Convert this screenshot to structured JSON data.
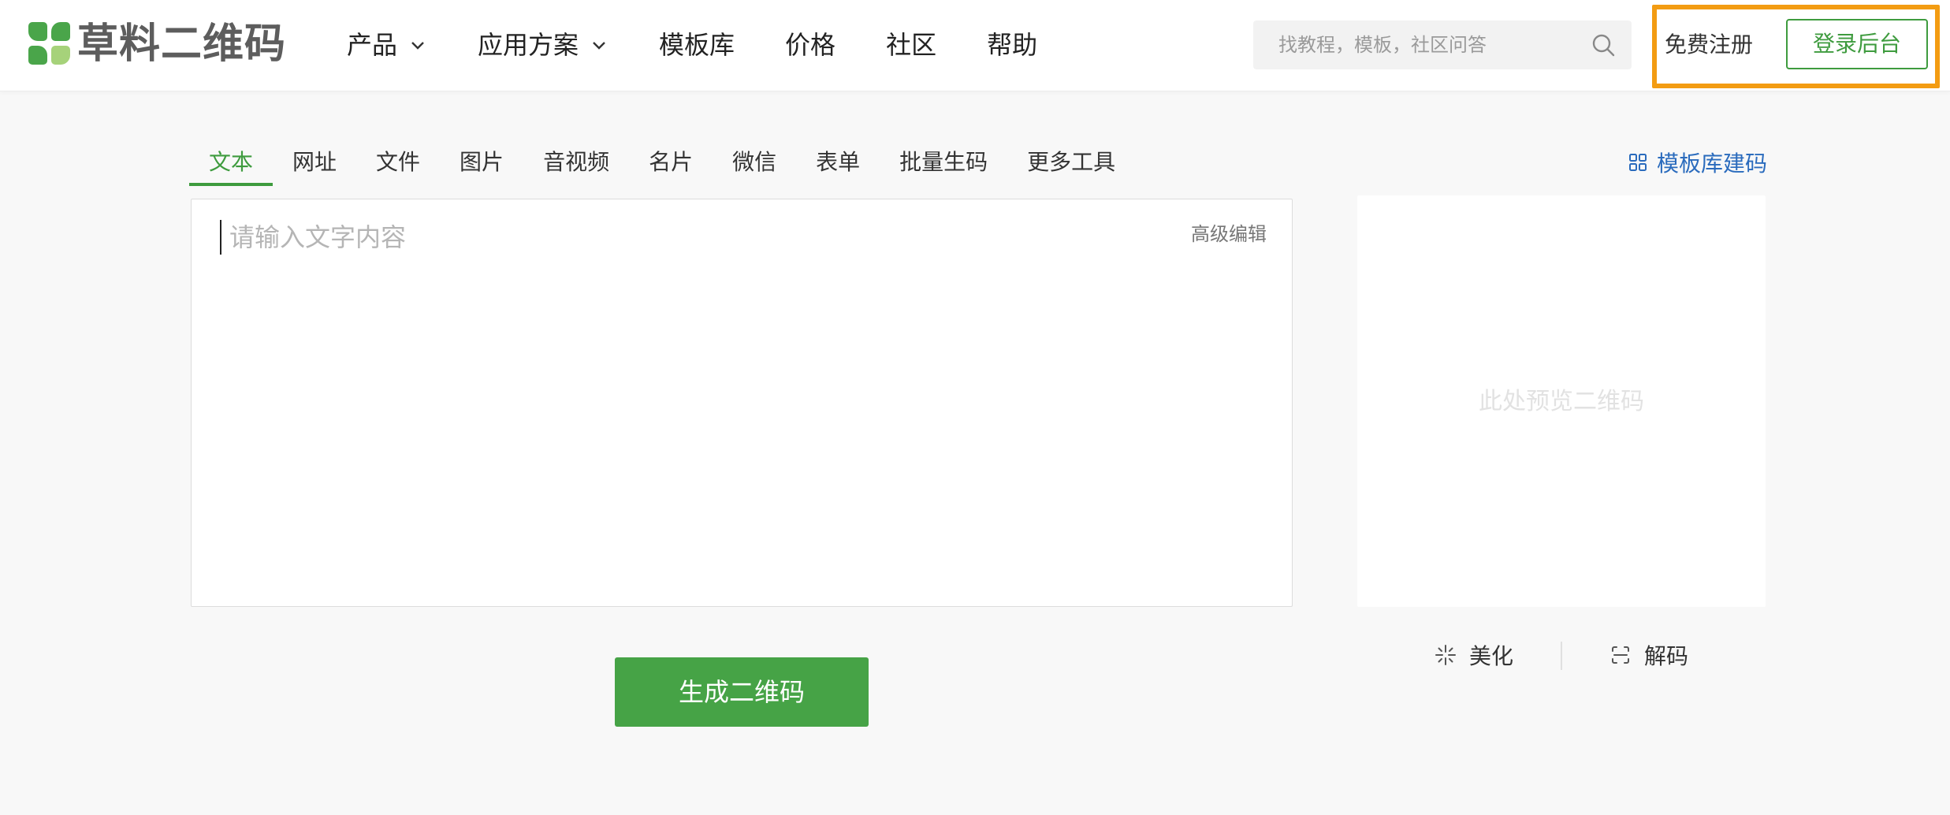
{
  "brand": {
    "name": "草料二维码",
    "primary_color": "#46a346",
    "accent_color": "#a6d27a"
  },
  "nav": {
    "items": [
      {
        "label": "产品",
        "dropdown": true
      },
      {
        "label": "应用方案",
        "dropdown": true
      },
      {
        "label": "模板库",
        "dropdown": false
      },
      {
        "label": "价格",
        "dropdown": false
      },
      {
        "label": "社区",
        "dropdown": false
      },
      {
        "label": "帮助",
        "dropdown": false
      }
    ]
  },
  "search": {
    "placeholder": "找教程，模板，社区问答",
    "value": "",
    "icon": "search-icon"
  },
  "account": {
    "register_label": "免费注册",
    "login_label": "登录后台",
    "highlight_color": "#f39c12"
  },
  "tabs": {
    "items": [
      "文本",
      "网址",
      "文件",
      "图片",
      "音视频",
      "名片",
      "微信",
      "表单",
      "批量生码",
      "更多工具"
    ],
    "active_index": 0
  },
  "template_link": {
    "label": "模板库建码",
    "icon": "grid-icon",
    "color": "#2a6bbd"
  },
  "editor": {
    "placeholder": "请输入文字内容",
    "value": "",
    "advanced_label": "高级编辑"
  },
  "preview": {
    "placeholder": "此处预览二维码",
    "beautify_label": "美化",
    "beautify_icon": "sparkle-icon",
    "decode_label": "解码",
    "decode_icon": "scan-icon"
  },
  "generate_label": "生成二维码"
}
